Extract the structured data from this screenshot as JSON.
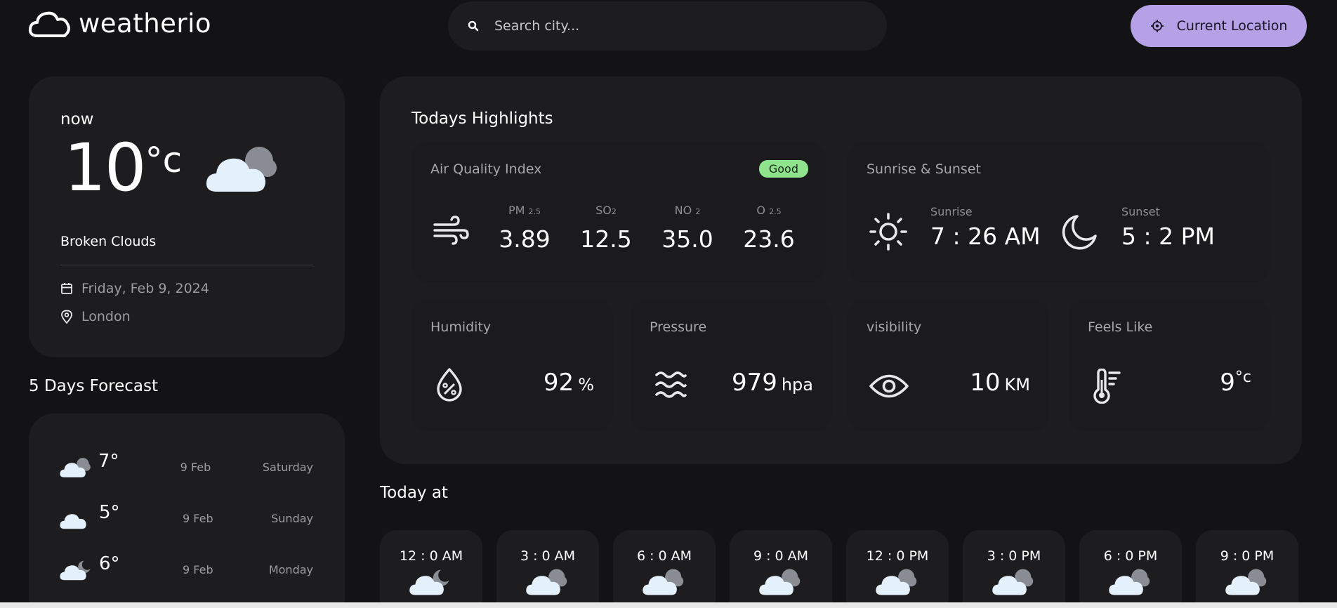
{
  "app": {
    "name": "weatherio"
  },
  "search": {
    "placeholder": "Search city..."
  },
  "current_location_label": "Current Location",
  "now": {
    "label": "now",
    "temp": "10",
    "unit": "°c",
    "description": "Broken Clouds",
    "date": "Friday, Feb 9, 2024",
    "location": "London"
  },
  "forecast": {
    "title": "5 Days Forecast",
    "days": [
      {
        "temp": "7°",
        "date": "9 Feb",
        "day": "Saturday",
        "icon": "broken-clouds-icon"
      },
      {
        "temp": "5°",
        "date": "9 Feb",
        "day": "Sunday",
        "icon": "cloud-icon"
      },
      {
        "temp": "6°",
        "date": "9 Feb",
        "day": "Monday",
        "icon": "cloud-moon-icon"
      }
    ]
  },
  "highlights": {
    "title": "Todays Highlights",
    "air_quality": {
      "title": "Air Quality Index",
      "badge": "Good",
      "items": [
        {
          "label": "PM",
          "sub": "2.5",
          "value": "3.89"
        },
        {
          "label": "SO",
          "sub": "2",
          "value": "12.5"
        },
        {
          "label": "NO",
          "sub": "2",
          "value": "35.0"
        },
        {
          "label": "O",
          "sub": "2.5",
          "value": "23.6"
        }
      ]
    },
    "sun": {
      "title": "Sunrise & Sunset",
      "sunrise_label": "Sunrise",
      "sunrise": "7 : 26 AM",
      "sunset_label": "Sunset",
      "sunset": "5 : 2 PM"
    },
    "humidity": {
      "title": "Humidity",
      "value": "92",
      "unit": "%"
    },
    "pressure": {
      "title": "Pressure",
      "value": "979",
      "unit": "hpa"
    },
    "visibility": {
      "title": "visibility",
      "value": "10",
      "unit": "KM"
    },
    "feels_like": {
      "title": "Feels Like",
      "value": "9",
      "unit": "°c"
    }
  },
  "today_at": {
    "title": "Today at",
    "hours": [
      {
        "time": "12 : 0 AM",
        "icon": "cloud-moon-icon"
      },
      {
        "time": "3 : 0 AM",
        "icon": "broken-clouds-icon"
      },
      {
        "time": "6 : 0 AM",
        "icon": "broken-clouds-icon"
      },
      {
        "time": "9 : 0 AM",
        "icon": "broken-clouds-icon"
      },
      {
        "time": "12 : 0 PM",
        "icon": "broken-clouds-icon"
      },
      {
        "time": "3 : 0 PM",
        "icon": "broken-clouds-icon"
      },
      {
        "time": "6 : 0 PM",
        "icon": "broken-clouds-icon"
      },
      {
        "time": "9 : 0 PM",
        "icon": "broken-clouds-icon"
      }
    ]
  },
  "colors": {
    "background": "#131315",
    "card": "#1d1d1f",
    "accent": "#b5a1e5",
    "good": "#8fe38d"
  }
}
